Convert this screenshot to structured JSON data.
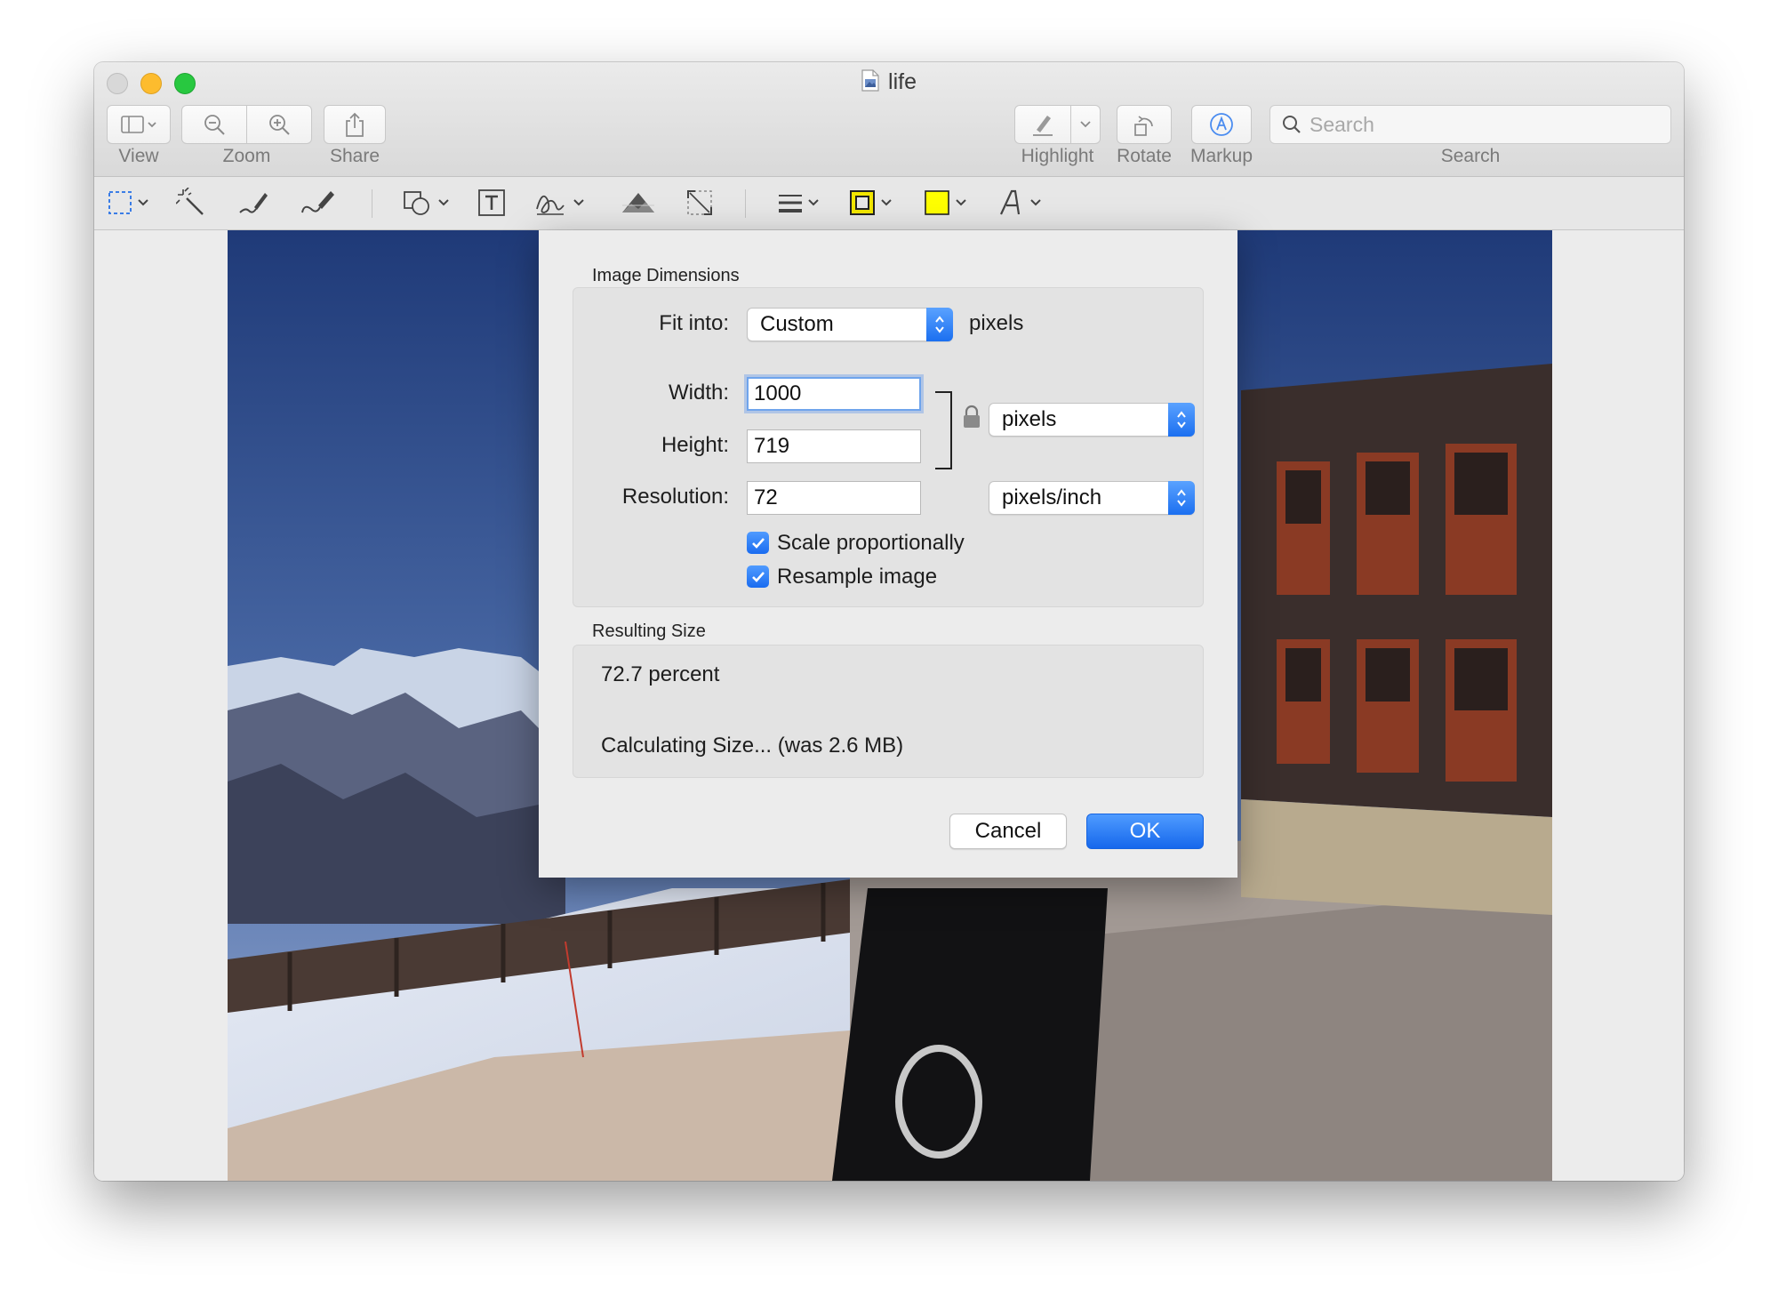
{
  "window": {
    "title": "life"
  },
  "toolbar": {
    "view_label": "View",
    "zoom_label": "Zoom",
    "share_label": "Share",
    "highlight_label": "Highlight",
    "rotate_label": "Rotate",
    "markup_label": "Markup",
    "search_label": "Search",
    "search_placeholder": "Search"
  },
  "markup_toolbar": {
    "tools": [
      "rectangular-selection",
      "instant-alpha",
      "sketch",
      "draw",
      "shapes",
      "text",
      "sign",
      "adjust-color",
      "adjust-size",
      "shape-style",
      "border-color",
      "fill-color",
      "text-style"
    ],
    "fill_color": "#ffff00",
    "border_color": "#222222"
  },
  "dialog": {
    "image_dimensions_title": "Image Dimensions",
    "fit_into_label": "Fit into:",
    "fit_into_value": "Custom",
    "fit_into_unit": "pixels",
    "width_label": "Width:",
    "width_value": "1000",
    "height_label": "Height:",
    "height_value": "719",
    "size_unit": "pixels",
    "resolution_label": "Resolution:",
    "resolution_value": "72",
    "resolution_unit": "pixels/inch",
    "scale_proportionally_label": "Scale proportionally",
    "scale_proportionally_checked": true,
    "resample_label": "Resample image",
    "resample_checked": true,
    "resulting_size_title": "Resulting Size",
    "percent_text": "72.7 percent",
    "size_text": "Calculating Size... (was 2.6 MB)",
    "cancel_label": "Cancel",
    "ok_label": "OK"
  },
  "colors": {
    "accent": "#1a6cf0",
    "traffic_close": "#d8d8d8",
    "traffic_minimize": "#fdbc2e",
    "traffic_maximize": "#28c840"
  }
}
